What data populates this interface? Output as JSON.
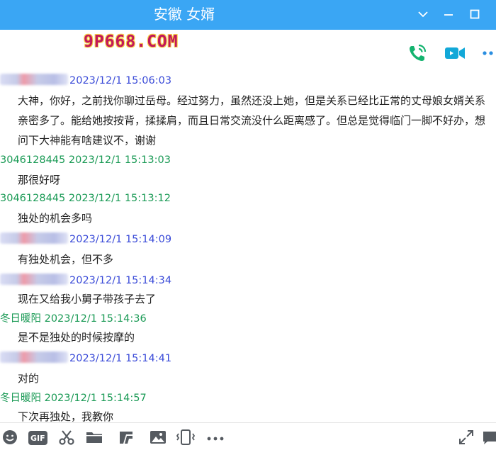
{
  "window": {
    "title": "安徽 女婿"
  },
  "watermark": {
    "logo_text": "9P668.COM"
  },
  "actions": {
    "voice_call_icon": "phone-icon",
    "video_call_icon": "video-camera-icon",
    "more_icon": "more-dots-icon"
  },
  "colors": {
    "titlebar": "#3aa6f4",
    "self_timestamp": "#3a4bd8",
    "other_sender": "#1a9a55",
    "phone_icon": "#14b36f",
    "video_icon": "#12a8d8"
  },
  "messages": [
    {
      "sender": "",
      "timestamp": "2023/12/1 15:06:03",
      "text": "大神，你好，之前找你聊过岳母。经过努力，虽然还没上她，但是关系已经比正常的丈母娘女婿关系亲密多了。能给她按按背，揉揉肩，而且日常交流没什么距离感了。但总是觉得临门一脚不好办，想问下大神能有啥建议不，谢谢"
    },
    {
      "sender": "3046128445",
      "timestamp": "2023/12/1 15:13:03",
      "text": "那很好呀"
    },
    {
      "sender": "3046128445",
      "timestamp": "2023/12/1 15:13:12",
      "text": "独处的机会多吗"
    },
    {
      "sender": "",
      "timestamp": "2023/12/1 15:14:09",
      "text": "有独处机会，但不多"
    },
    {
      "sender": "",
      "timestamp": "2023/12/1 15:14:34",
      "text": "现在又给我小舅子带孩子去了"
    },
    {
      "sender": "冬日暖阳",
      "timestamp": "2023/12/1 15:14:36",
      "text": "是不是独处的时候按摩的"
    },
    {
      "sender": "",
      "timestamp": "2023/12/1 15:14:41",
      "text": "对的"
    },
    {
      "sender": "冬日暖阳",
      "timestamp": "2023/12/1 15:14:57",
      "text": "下次再独处，我教你"
    }
  ],
  "toolbar": {
    "gif_label": "GIF",
    "icons": [
      "emoji-icon",
      "gif-icon",
      "scissors-icon",
      "folder-icon",
      "music-icon",
      "image-icon",
      "phone-vibrate-icon",
      "more-dots-icon",
      "expand-icon",
      "chat-bubble-icon"
    ]
  }
}
